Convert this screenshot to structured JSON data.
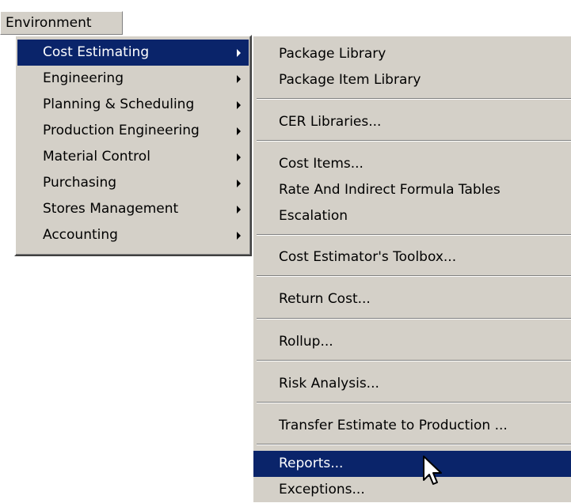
{
  "menubar": {
    "environment_label": "Environment"
  },
  "main_menu": {
    "items": [
      {
        "label": "Cost Estimating"
      },
      {
        "label": "Engineering"
      },
      {
        "label": "Planning & Scheduling"
      },
      {
        "label": "Production Engineering"
      },
      {
        "label": "Material Control"
      },
      {
        "label": "Purchasing"
      },
      {
        "label": "Stores Management"
      },
      {
        "label": "Accounting"
      }
    ]
  },
  "submenu": {
    "items": [
      {
        "label": "Package Library"
      },
      {
        "label": "Package Item Library"
      },
      {
        "label": "CER Libraries..."
      },
      {
        "label": "Cost Items..."
      },
      {
        "label": "Rate And Indirect Formula Tables"
      },
      {
        "label": "Escalation"
      },
      {
        "label": "Cost Estimator's Toolbox..."
      },
      {
        "label": "Return Cost..."
      },
      {
        "label": "Rollup..."
      },
      {
        "label": "Risk Analysis..."
      },
      {
        "label": "Transfer Estimate to Production ..."
      },
      {
        "label": "Reports..."
      },
      {
        "label": "Exceptions..."
      }
    ]
  },
  "colors": {
    "menu_background": "#d4d0c8",
    "selection_background": "#0a246a",
    "selection_text": "#ffffff"
  }
}
